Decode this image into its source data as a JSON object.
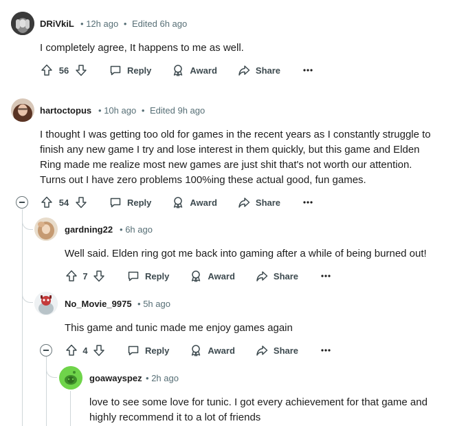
{
  "comments": [
    {
      "author": "DRiVkiL",
      "time": "12h ago",
      "edited": "Edited 6h ago",
      "lines": [
        "I completely agree, It happens to me as well."
      ],
      "votes": "56"
    },
    {
      "author": "hartoctopus",
      "time": "10h ago",
      "edited": "Edited 9h ago",
      "lines": [
        "I thought I was getting too old for games in the recent years as I constantly struggle to",
        "finish any new game I try and lose interest in them quickly, but this game and Elden",
        "Ring made me realize most new games are just shit that's not worth our attention.",
        "Turns out I have zero problems 100%ing these actual good, fun games."
      ],
      "votes": "54"
    },
    {
      "author": "gardning22",
      "time": "6h ago",
      "lines": [
        "Well said. Elden ring got me back into gaming after a while of being burned out!"
      ],
      "votes": "7"
    },
    {
      "author": "No_Movie_9975",
      "time": "5h ago",
      "lines": [
        "This game and tunic made me enjoy games again"
      ],
      "votes": "4"
    },
    {
      "author": "goawayspez",
      "time": "2h ago",
      "lines": [
        "love to see some love for tunic. I got every achievement for that game and",
        "highly recommend it to a lot of friends"
      ]
    }
  ],
  "labels": {
    "reply": "Reply",
    "award": "Award",
    "share": "Share",
    "dot": "•"
  },
  "icons": {
    "upvote": "upvote-arrow-icon",
    "downvote": "downvote-arrow-icon",
    "reply": "speech-bubble-icon",
    "award": "award-ribbon-icon",
    "share": "share-arrow-icon",
    "more": "ellipsis-icon",
    "collapse": "collapse-minus-icon"
  },
  "colors": {
    "meta": "#576f76",
    "text": "#1c1c1c",
    "thread": "#cfd6d9",
    "snoo_green": "#6fd44a"
  }
}
